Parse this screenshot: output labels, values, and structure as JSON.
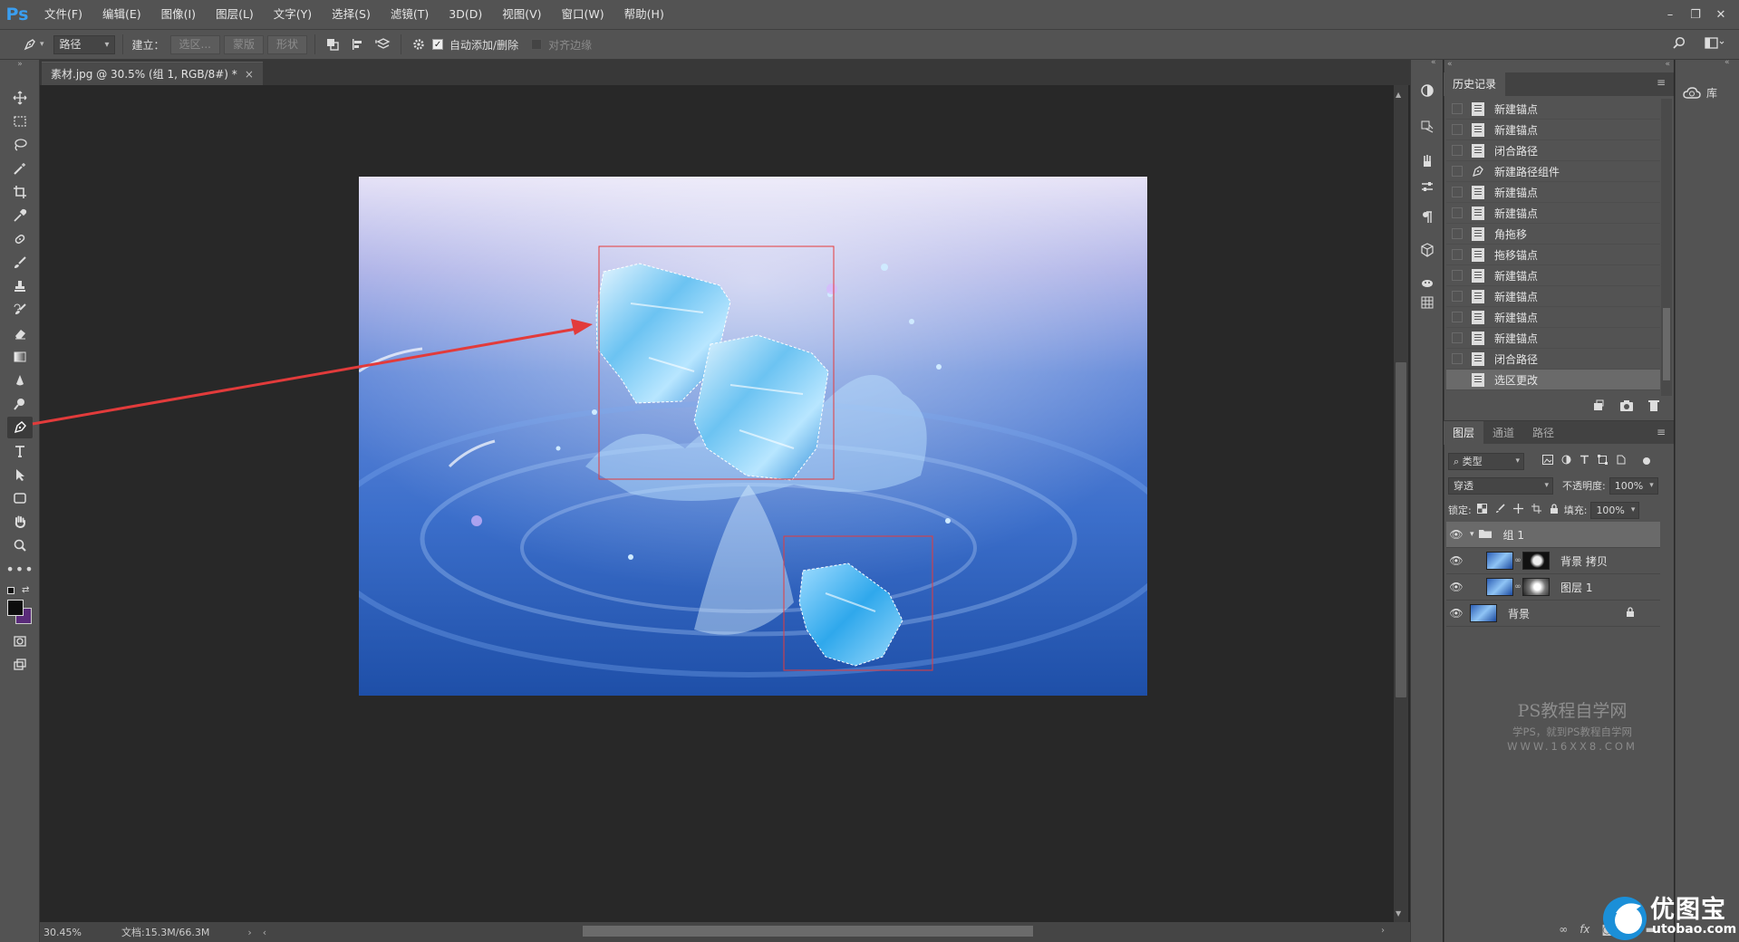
{
  "app": {
    "logo": "Ps"
  },
  "menu": [
    "文件(F)",
    "编辑(E)",
    "图像(I)",
    "图层(L)",
    "文字(Y)",
    "选择(S)",
    "滤镜(T)",
    "3D(D)",
    "视图(V)",
    "窗口(W)",
    "帮助(H)"
  ],
  "window_controls": {
    "minimize": "–",
    "restore": "❐",
    "close": "✕"
  },
  "options": {
    "mode": "路径",
    "build_label": "建立：",
    "selection_btn": "选区...",
    "mask_btn": "蒙版",
    "shape_btn": "形状",
    "auto_add_label": "自动添加/删除",
    "auto_add_checked": true,
    "align_edges_label": "对齐边缘",
    "align_edges_checked": false
  },
  "document_tab": {
    "title": "素材.jpg @ 30.5% (组 1, RGB/8#) *",
    "close": "×"
  },
  "status": {
    "zoom": "30.45%",
    "doc_size": "文档:15.3M/66.3M"
  },
  "history": {
    "tab": "历史记录",
    "items": [
      {
        "label": "新建锚点",
        "icon": "document-icon",
        "selected": false
      },
      {
        "label": "新建锚点",
        "icon": "document-icon",
        "selected": false
      },
      {
        "label": "闭合路径",
        "icon": "document-icon",
        "selected": false
      },
      {
        "label": "新建路径组件",
        "icon": "pen-icon",
        "selected": false
      },
      {
        "label": "新建锚点",
        "icon": "document-icon",
        "selected": false
      },
      {
        "label": "新建锚点",
        "icon": "document-icon",
        "selected": false
      },
      {
        "label": "角拖移",
        "icon": "document-icon",
        "selected": false
      },
      {
        "label": "拖移锚点",
        "icon": "document-icon",
        "selected": false
      },
      {
        "label": "新建锚点",
        "icon": "document-icon",
        "selected": false
      },
      {
        "label": "新建锚点",
        "icon": "document-icon",
        "selected": false
      },
      {
        "label": "新建锚点",
        "icon": "document-icon",
        "selected": false
      },
      {
        "label": "新建锚点",
        "icon": "document-icon",
        "selected": false
      },
      {
        "label": "闭合路径",
        "icon": "document-icon",
        "selected": false
      },
      {
        "label": "选区更改",
        "icon": "document-icon",
        "selected": true
      }
    ]
  },
  "layers_panel": {
    "tabs": [
      "图层",
      "通道",
      "路径"
    ],
    "filter": "类型",
    "blend_mode": "穿透",
    "opacity_label": "不透明度:",
    "opacity": "100%",
    "lock_label": "锁定:",
    "fill_label": "填充:",
    "fill": "100%",
    "layers": [
      {
        "name": "组 1",
        "type": "group",
        "selected": true
      },
      {
        "name": "背景 拷贝",
        "type": "masked",
        "selected": false
      },
      {
        "name": "图层 1",
        "type": "masked",
        "selected": false
      },
      {
        "name": "背景",
        "type": "background",
        "selected": false,
        "locked": true
      }
    ]
  },
  "library": {
    "label": "库"
  },
  "watermark": {
    "line1": "PS教程自学网",
    "line2": "学PS，就到PS教程自学网",
    "line3": "WWW.16XX8.COM"
  },
  "corner_logo": {
    "brand": "优图宝",
    "url": "utobao.com"
  }
}
